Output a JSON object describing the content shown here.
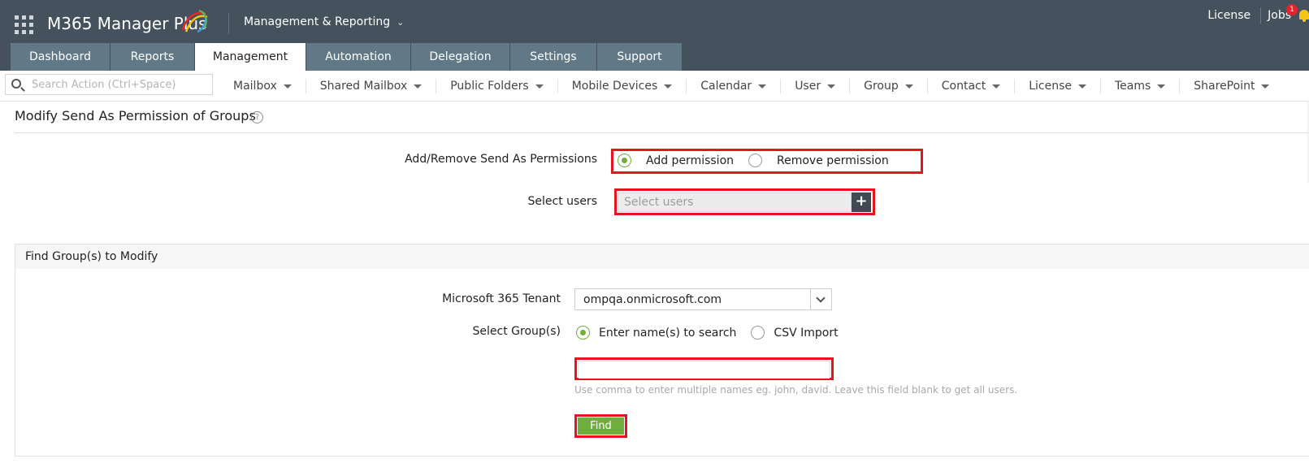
{
  "header": {
    "brand": "M365 Manager Plus",
    "module": "Management & Reporting",
    "license_link": "License",
    "jobs_link": "Jobs",
    "jobs_badge": "1",
    "bell_icon": "bell-icon",
    "accent_color": "#45525d"
  },
  "tabs": [
    {
      "label": "Dashboard"
    },
    {
      "label": "Reports"
    },
    {
      "label": "Management",
      "active": true
    },
    {
      "label": "Automation"
    },
    {
      "label": "Delegation"
    },
    {
      "label": "Settings"
    },
    {
      "label": "Support"
    }
  ],
  "search": {
    "placeholder": "Search Action (Ctrl+Space)"
  },
  "subnav": [
    {
      "label": "Mailbox"
    },
    {
      "label": "Shared Mailbox"
    },
    {
      "label": "Public Folders"
    },
    {
      "label": "Mobile Devices"
    },
    {
      "label": "Calendar"
    },
    {
      "label": "User"
    },
    {
      "label": "Group"
    },
    {
      "label": "Contact"
    },
    {
      "label": "License"
    },
    {
      "label": "Teams"
    },
    {
      "label": "SharePoint"
    }
  ],
  "page": {
    "title": "Modify Send As Permission of Groups",
    "help": "?"
  },
  "permissions": {
    "label": "Add/Remove Send As Permissions",
    "add": "Add permission",
    "remove": "Remove permission",
    "selected": "add"
  },
  "select_users": {
    "label": "Select users",
    "placeholder": "Select users",
    "add_button": "+"
  },
  "find": {
    "heading": "Find Group(s) to Modify",
    "tenant_label": "Microsoft 365 Tenant",
    "tenant_value": "ompqa.onmicrosoft.com",
    "groups_label": "Select Group(s)",
    "option_search": "Enter name(s) to search",
    "option_csv": "CSV Import",
    "selected": "search",
    "names_value": "",
    "hint": "Use comma to enter multiple names eg. john, david. Leave this field blank to get all users.",
    "find_button": "Find"
  },
  "colors": {
    "highlight": "#e6141e",
    "green": "#6fae3a"
  }
}
